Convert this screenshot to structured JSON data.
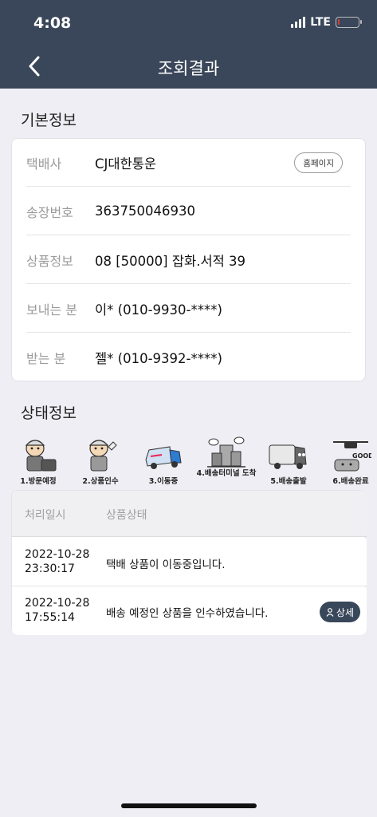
{
  "status_bar": {
    "time": "4:08",
    "network": "LTE",
    "battery_percent": 10
  },
  "header": {
    "title": "조회결과",
    "back_icon": "chevron-left-icon"
  },
  "basic_info": {
    "section_title": "기본정보",
    "homepage_button": "홈페이지",
    "rows": [
      {
        "label": "택배사",
        "value": "CJ대한통운"
      },
      {
        "label": "송장번호",
        "value": "363750046930"
      },
      {
        "label": "상품정보",
        "value": "08 [50000] 잡화.서적 39"
      },
      {
        "label": "보내는 분",
        "value": "이* (010-9930-****)"
      },
      {
        "label": "받는 분",
        "value": "젤* (010-9392-****)"
      }
    ]
  },
  "status_info": {
    "section_title": "상태정보",
    "steps": [
      {
        "label": "1.방문예정",
        "icon": "courier-worker-icon"
      },
      {
        "label": "2.상품인수",
        "icon": "courier-box-icon"
      },
      {
        "label": "3.이동중",
        "icon": "delivery-truck-icon"
      },
      {
        "label": "4.배송터미널 도착",
        "icon": "terminal-building-icon"
      },
      {
        "label": "5.배송출발",
        "icon": "truck-character-icon"
      },
      {
        "label": "6.배송완료",
        "icon": "drone-good-icon"
      }
    ]
  },
  "history": {
    "col_time": "처리일시",
    "col_status": "상품상태",
    "rows": [
      {
        "date": "2022-10-28",
        "time": "23:30:17",
        "status": "택배 상품이 이동중입니다.",
        "detail": ""
      },
      {
        "date": "2022-10-28",
        "time": "17:55:14",
        "status": "배송 예정인 상품을 인수하였습니다.",
        "detail": "상세"
      }
    ]
  },
  "colors": {
    "header_bg": "#3a475a",
    "page_bg": "#efeef4",
    "detail_button": "#38475a"
  }
}
